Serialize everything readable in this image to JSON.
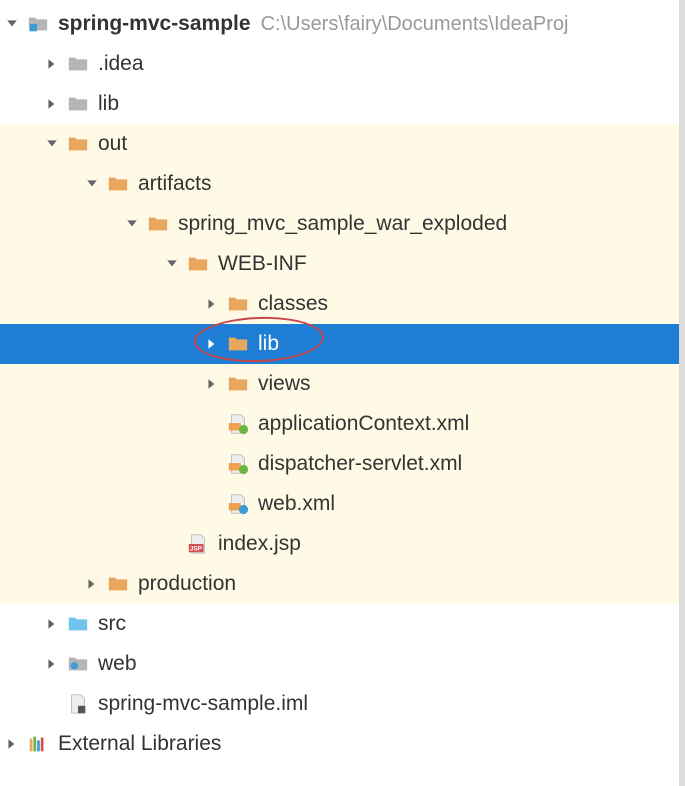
{
  "project": {
    "name": "spring-mvc-sample",
    "path": "C:\\Users\\fairy\\Documents\\IdeaProj"
  },
  "tree": {
    "idea": ".idea",
    "lib": "lib",
    "out": "out",
    "artifacts": "artifacts",
    "war_exploded": "spring_mvc_sample_war_exploded",
    "webinf": "WEB-INF",
    "classes": "classes",
    "lib_selected": "lib",
    "views": "views",
    "app_context": "applicationContext.xml",
    "dispatcher": "dispatcher-servlet.xml",
    "webxml": "web.xml",
    "index_jsp": "index.jsp",
    "production": "production",
    "src": "src",
    "web": "web",
    "iml": "spring-mvc-sample.iml",
    "ext_libs": "External Libraries"
  },
  "colors": {
    "folder_orange": "#e8a65f",
    "folder_gray": "#b5b5b5",
    "folder_blue": "#6fc3ec",
    "folder_webblue": "#9cc6e0",
    "selected_bg": "#1e7ed6",
    "highlight_bg": "#fffae6"
  }
}
